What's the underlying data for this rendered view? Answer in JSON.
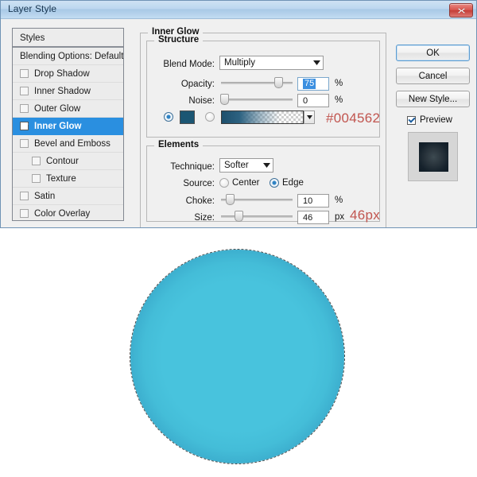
{
  "window": {
    "title": "Layer Style",
    "close_icon": "close-x-icon"
  },
  "styles_panel": {
    "header": "Styles",
    "items": [
      {
        "label": "Blending Options: Default",
        "checkbox": false,
        "has_checkbox": false,
        "selected": false,
        "indent": false
      },
      {
        "label": "Drop Shadow",
        "checkbox": false,
        "has_checkbox": true,
        "selected": false,
        "indent": false
      },
      {
        "label": "Inner Shadow",
        "checkbox": false,
        "has_checkbox": true,
        "selected": false,
        "indent": false
      },
      {
        "label": "Outer Glow",
        "checkbox": false,
        "has_checkbox": true,
        "selected": false,
        "indent": false
      },
      {
        "label": "Inner Glow",
        "checkbox": true,
        "has_checkbox": true,
        "selected": true,
        "indent": false
      },
      {
        "label": "Bevel and Emboss",
        "checkbox": false,
        "has_checkbox": true,
        "selected": false,
        "indent": false
      },
      {
        "label": "Contour",
        "checkbox": false,
        "has_checkbox": true,
        "selected": false,
        "indent": true
      },
      {
        "label": "Texture",
        "checkbox": false,
        "has_checkbox": true,
        "selected": false,
        "indent": true
      },
      {
        "label": "Satin",
        "checkbox": false,
        "has_checkbox": true,
        "selected": false,
        "indent": false
      },
      {
        "label": "Color Overlay",
        "checkbox": false,
        "has_checkbox": true,
        "selected": false,
        "indent": false
      }
    ]
  },
  "inner_glow": {
    "group_title": "Inner Glow",
    "structure": {
      "group_title": "Structure",
      "blend_mode": {
        "label": "Blend Mode:",
        "value": "Multiply"
      },
      "opacity": {
        "label": "Opacity:",
        "value": "75",
        "unit": "%",
        "slider_pct": 75
      },
      "noise": {
        "label": "Noise:",
        "value": "0",
        "unit": "%",
        "slider_pct": 0
      },
      "fill_type": {
        "color_radio_selected": true,
        "gradient_radio_selected": false,
        "color_value": "#1b5673",
        "gradient_dropdown_icon": "chevron-down-icon"
      },
      "annotation_color": "#004562"
    },
    "elements": {
      "group_title": "Elements",
      "technique": {
        "label": "Technique:",
        "value": "Softer"
      },
      "source": {
        "label": "Source:",
        "option_center": "Center",
        "option_edge": "Edge",
        "selected": "Edge"
      },
      "choke": {
        "label": "Choke:",
        "value": "10",
        "unit": "%",
        "slider_pct": 10
      },
      "size": {
        "label": "Size:",
        "value": "46",
        "unit": "px",
        "slider_pct": 18
      },
      "annotation_size": "46px"
    }
  },
  "buttons": {
    "ok": "OK",
    "cancel": "Cancel",
    "new_style": "New Style...",
    "preview": {
      "label": "Preview",
      "checked": true
    }
  },
  "colors": {
    "accent_selected_row": "#2a8fe0",
    "annotation_red": "#c1554f",
    "glow_color": "#004562",
    "circle_fill": "#48c3dd",
    "circle_edge": "#1b6489",
    "titlebar_text": "#16344f"
  },
  "canvas": {
    "shape_name": "circle-with-inner-glow"
  }
}
